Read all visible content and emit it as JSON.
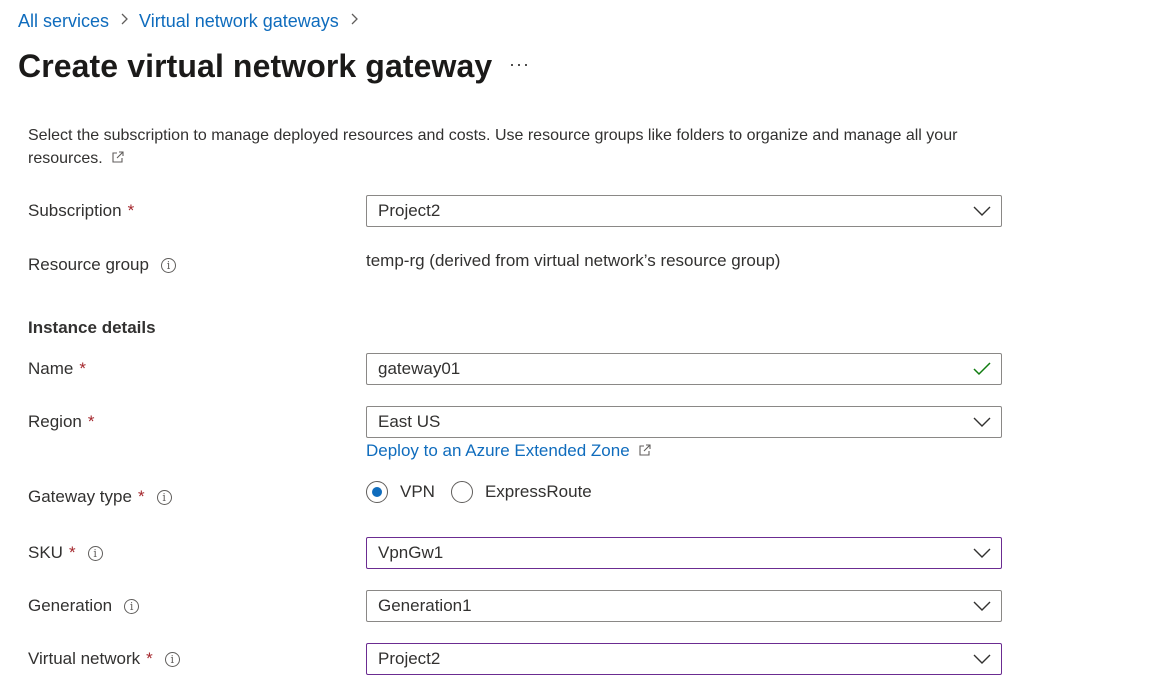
{
  "breadcrumb": {
    "items": [
      "All services",
      "Virtual network gateways"
    ]
  },
  "page": {
    "title": "Create virtual network gateway",
    "more": "···"
  },
  "description": "Select the subscription to manage deployed resources and costs. Use resource groups like folders to organize and manage all your resources.",
  "form": {
    "subscription": {
      "label": "Subscription",
      "value": "Project2"
    },
    "resource_group": {
      "label": "Resource group",
      "value": "temp-rg (derived from virtual network’s resource group)"
    },
    "instance_details": "Instance details",
    "name": {
      "label": "Name",
      "value": "gateway01"
    },
    "region": {
      "label": "Region",
      "value": "East US",
      "link": "Deploy to an Azure Extended Zone"
    },
    "gateway_type": {
      "label": "Gateway type",
      "options": [
        "VPN",
        "ExpressRoute"
      ],
      "selected": "VPN"
    },
    "sku": {
      "label": "SKU",
      "value": "VpnGw1"
    },
    "generation": {
      "label": "Generation",
      "value": "Generation1"
    },
    "virtual_network": {
      "label": "Virtual network",
      "value": "Project2"
    }
  },
  "required_marker": "*",
  "info_glyph": "i",
  "icons": [
    "chevron-right-icon",
    "more-icon",
    "external-link-icon",
    "info-icon",
    "chevron-down-icon",
    "checkmark-icon"
  ],
  "colors": {
    "link": "#0f6cbd",
    "required": "#a4262c",
    "valid": "#107c10",
    "focus_border": "#6b2c91"
  }
}
